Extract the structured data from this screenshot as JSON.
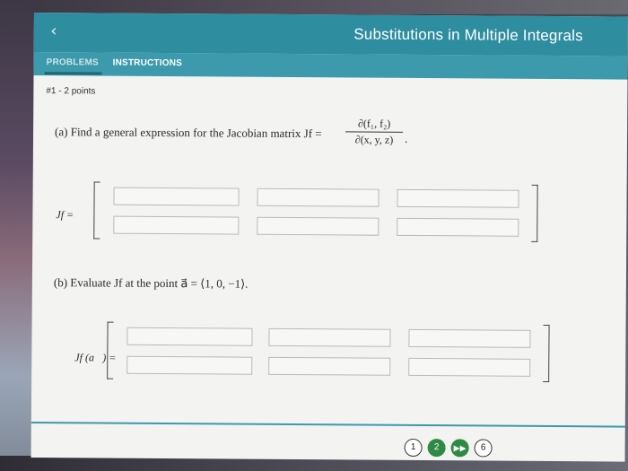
{
  "header": {
    "back_icon": "chevron-left-icon",
    "back_glyph": "‹",
    "title": "Substitutions in Multiple Integrals"
  },
  "tabs": [
    {
      "label": "PROBLEMS",
      "active": true
    },
    {
      "label": "INSTRUCTIONS",
      "active": false
    }
  ],
  "problem": {
    "points": "#1 - 2 points",
    "part_a_text": "(a) Find a general expression for the Jacobian matrix Jf =",
    "fraction_numerator": "∂(f₁, f₂)",
    "fraction_denominator": "∂(x, y, z)",
    "fraction_tail": ".",
    "label_jf": "Jf =",
    "part_b_text": "(b) Evaluate Jf at the point a⃗ = ⟨1, 0, −1⟩.",
    "label_jfa": "Jf (a⃗) ="
  },
  "matrix_a": {
    "rows": [
      [
        "",
        "",
        ""
      ],
      [
        "",
        "",
        ""
      ]
    ]
  },
  "matrix_b": {
    "rows": [
      [
        "",
        "",
        ""
      ],
      [
        "",
        "",
        ""
      ]
    ]
  },
  "pagination": {
    "first": "1",
    "current": "2",
    "next_icon": "fast-forward-icon",
    "next_glyph": "▶▶",
    "last": "6"
  },
  "colors": {
    "header_bg": "#2f8da0",
    "tabbar_bg": "#3c9aac",
    "accent_green": "#2f8a45"
  }
}
